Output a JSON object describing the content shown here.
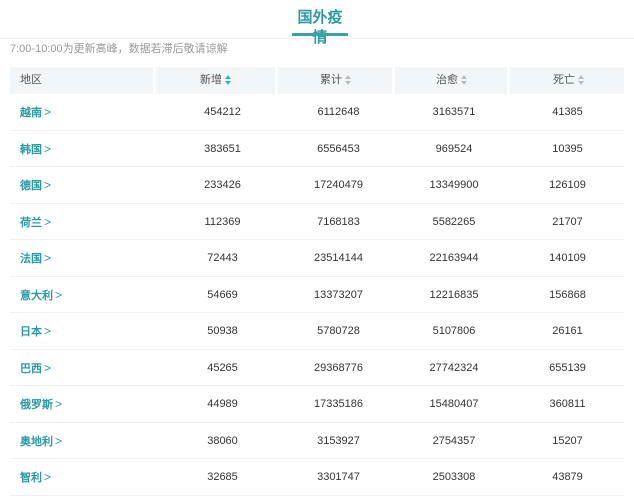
{
  "tab": {
    "title": "国外疫情"
  },
  "notice": "7:00-10:00为更新高峰，数据若滞后敬请谅解",
  "table": {
    "headers": {
      "region": "地区",
      "new": "新增",
      "total": "累计",
      "cured": "治愈",
      "deaths": "死亡"
    },
    "sort_active": "new",
    "rows": [
      {
        "region": "越南",
        "new": "454212",
        "total": "6112648",
        "cured": "3163571",
        "deaths": "41385"
      },
      {
        "region": "韩国",
        "new": "383651",
        "total": "6556453",
        "cured": "969524",
        "deaths": "10395"
      },
      {
        "region": "德国",
        "new": "233426",
        "total": "17240479",
        "cured": "13349900",
        "deaths": "126109"
      },
      {
        "region": "荷兰",
        "new": "112369",
        "total": "7168183",
        "cured": "5582265",
        "deaths": "21707"
      },
      {
        "region": "法国",
        "new": "72443",
        "total": "23514144",
        "cured": "22163944",
        "deaths": "140109"
      },
      {
        "region": "意大利",
        "new": "54669",
        "total": "13373207",
        "cured": "12216835",
        "deaths": "156868"
      },
      {
        "region": "日本",
        "new": "50938",
        "total": "5780728",
        "cured": "5107806",
        "deaths": "26161"
      },
      {
        "region": "巴西",
        "new": "45265",
        "total": "29368776",
        "cured": "27742324",
        "deaths": "655139"
      },
      {
        "region": "俄罗斯",
        "new": "44989",
        "total": "17335186",
        "cured": "15480407",
        "deaths": "360811"
      },
      {
        "region": "奥地利",
        "new": "38060",
        "total": "3153927",
        "cured": "2754357",
        "deaths": "15207"
      },
      {
        "region": "智利",
        "new": "32685",
        "total": "3301747",
        "cured": "2503308",
        "deaths": "43879"
      }
    ]
  },
  "colors": {
    "accent": "#2a9ba4",
    "header_bg": "#f3f6f8"
  }
}
